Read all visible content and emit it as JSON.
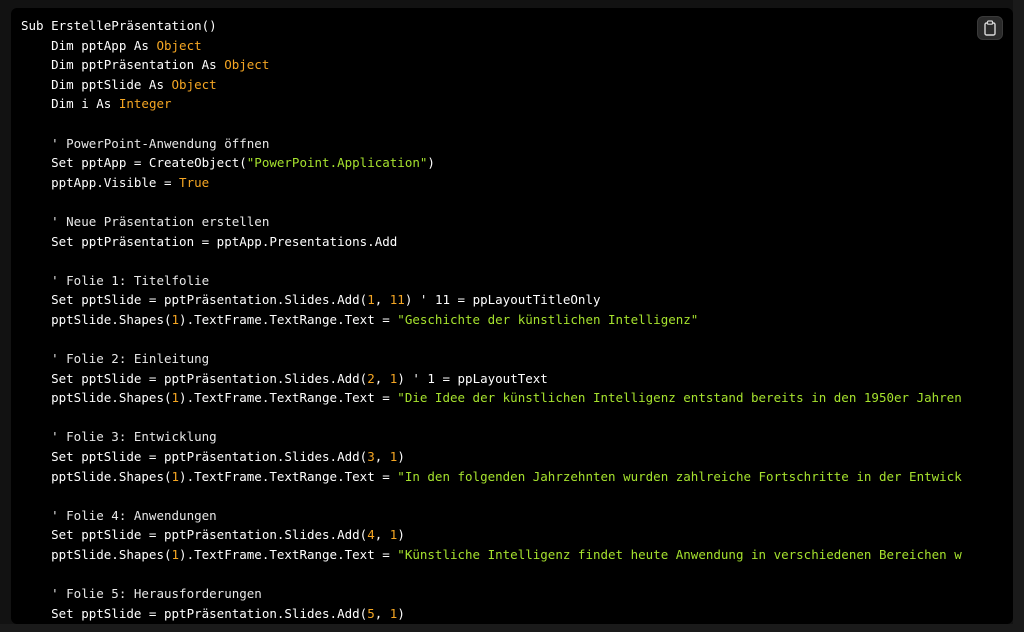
{
  "code": {
    "lines": [
      [
        {
          "t": "Sub ErstellePräsentation()",
          "c": "kw"
        }
      ],
      [
        {
          "t": "    Dim pptApp As ",
          "c": "kw"
        },
        {
          "t": "Object",
          "c": "type"
        }
      ],
      [
        {
          "t": "    Dim pptPräsentation As ",
          "c": "kw"
        },
        {
          "t": "Object",
          "c": "type"
        }
      ],
      [
        {
          "t": "    Dim pptSlide As ",
          "c": "kw"
        },
        {
          "t": "Object",
          "c": "type"
        }
      ],
      [
        {
          "t": "    Dim i As ",
          "c": "kw"
        },
        {
          "t": "Integer",
          "c": "type"
        }
      ],
      [
        {
          "t": "",
          "c": "kw"
        }
      ],
      [
        {
          "t": "    ' PowerPoint-Anwendung öffnen",
          "c": "cmt"
        }
      ],
      [
        {
          "t": "    Set pptApp = CreateObject(",
          "c": "kw"
        },
        {
          "t": "\"PowerPoint.Application\"",
          "c": "str"
        },
        {
          "t": ")",
          "c": "kw"
        }
      ],
      [
        {
          "t": "    pptApp.Visible = ",
          "c": "kw"
        },
        {
          "t": "True",
          "c": "type"
        }
      ],
      [
        {
          "t": "",
          "c": "kw"
        }
      ],
      [
        {
          "t": "    ' Neue Präsentation erstellen",
          "c": "cmt"
        }
      ],
      [
        {
          "t": "    Set pptPräsentation = pptApp.Presentations.Add",
          "c": "kw"
        }
      ],
      [
        {
          "t": "",
          "c": "kw"
        }
      ],
      [
        {
          "t": "    ' Folie 1: Titelfolie",
          "c": "cmt"
        }
      ],
      [
        {
          "t": "    Set pptSlide = pptPräsentation.Slides.Add(",
          "c": "kw"
        },
        {
          "t": "1",
          "c": "num"
        },
        {
          "t": ", ",
          "c": "kw"
        },
        {
          "t": "11",
          "c": "num"
        },
        {
          "t": ") ' 11 = ppLayoutTitleOnly",
          "c": "kw"
        }
      ],
      [
        {
          "t": "    pptSlide.Shapes(",
          "c": "kw"
        },
        {
          "t": "1",
          "c": "num"
        },
        {
          "t": ").TextFrame.TextRange.Text = ",
          "c": "kw"
        },
        {
          "t": "\"Geschichte der künstlichen Intelligenz\"",
          "c": "str"
        }
      ],
      [
        {
          "t": "",
          "c": "kw"
        }
      ],
      [
        {
          "t": "    ' Folie 2: Einleitung",
          "c": "cmt"
        }
      ],
      [
        {
          "t": "    Set pptSlide = pptPräsentation.Slides.Add(",
          "c": "kw"
        },
        {
          "t": "2",
          "c": "num"
        },
        {
          "t": ", ",
          "c": "kw"
        },
        {
          "t": "1",
          "c": "num"
        },
        {
          "t": ") ' 1 = ppLayoutText",
          "c": "kw"
        }
      ],
      [
        {
          "t": "    pptSlide.Shapes(",
          "c": "kw"
        },
        {
          "t": "1",
          "c": "num"
        },
        {
          "t": ").TextFrame.TextRange.Text = ",
          "c": "kw"
        },
        {
          "t": "\"Die Idee der künstlichen Intelligenz entstand bereits in den 1950er Jahren",
          "c": "str"
        }
      ],
      [
        {
          "t": "",
          "c": "kw"
        }
      ],
      [
        {
          "t": "    ' Folie 3: Entwicklung",
          "c": "cmt"
        }
      ],
      [
        {
          "t": "    Set pptSlide = pptPräsentation.Slides.Add(",
          "c": "kw"
        },
        {
          "t": "3",
          "c": "num"
        },
        {
          "t": ", ",
          "c": "kw"
        },
        {
          "t": "1",
          "c": "num"
        },
        {
          "t": ")",
          "c": "kw"
        }
      ],
      [
        {
          "t": "    pptSlide.Shapes(",
          "c": "kw"
        },
        {
          "t": "1",
          "c": "num"
        },
        {
          "t": ").TextFrame.TextRange.Text = ",
          "c": "kw"
        },
        {
          "t": "\"In den folgenden Jahrzehnten wurden zahlreiche Fortschritte in der Entwick",
          "c": "str"
        }
      ],
      [
        {
          "t": "",
          "c": "kw"
        }
      ],
      [
        {
          "t": "    ' Folie 4: Anwendungen",
          "c": "cmt"
        }
      ],
      [
        {
          "t": "    Set pptSlide = pptPräsentation.Slides.Add(",
          "c": "kw"
        },
        {
          "t": "4",
          "c": "num"
        },
        {
          "t": ", ",
          "c": "kw"
        },
        {
          "t": "1",
          "c": "num"
        },
        {
          "t": ")",
          "c": "kw"
        }
      ],
      [
        {
          "t": "    pptSlide.Shapes(",
          "c": "kw"
        },
        {
          "t": "1",
          "c": "num"
        },
        {
          "t": ").TextFrame.TextRange.Text = ",
          "c": "kw"
        },
        {
          "t": "\"Künstliche Intelligenz findet heute Anwendung in verschiedenen Bereichen w",
          "c": "str"
        }
      ],
      [
        {
          "t": "",
          "c": "kw"
        }
      ],
      [
        {
          "t": "    ' Folie 5: Herausforderungen",
          "c": "cmt"
        }
      ],
      [
        {
          "t": "    Set pptSlide = pptPräsentation.Slides.Add(",
          "c": "kw"
        },
        {
          "t": "5",
          "c": "num"
        },
        {
          "t": ", ",
          "c": "kw"
        },
        {
          "t": "1",
          "c": "num"
        },
        {
          "t": ")",
          "c": "kw"
        }
      ]
    ]
  },
  "colors": {
    "keyword": "#ffffff",
    "type": "#f5a623",
    "number": "#f5a623",
    "string": "#a6e22e",
    "background": "#000000"
  },
  "toolbar": {
    "copy_icon": "clipboard-icon"
  }
}
